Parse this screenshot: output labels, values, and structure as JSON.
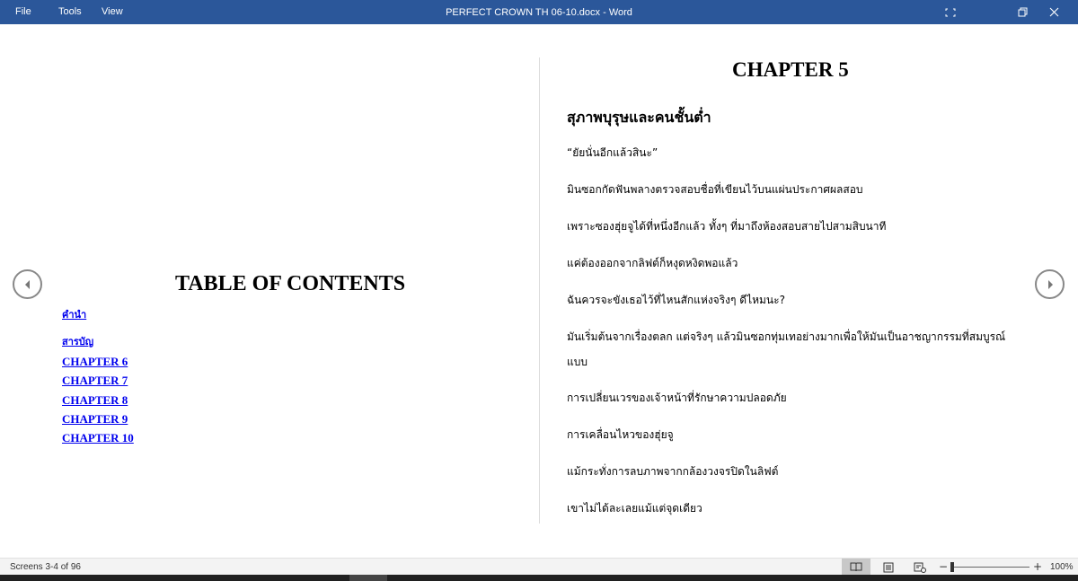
{
  "menu": {
    "file": "File",
    "tools": "Tools",
    "view": "View"
  },
  "window": {
    "title": "PERFECT CROWN TH 06-10.docx  -  Word"
  },
  "icons": {
    "focus": "focus-mode-icon",
    "restore": "restore-icon",
    "close": "close-icon",
    "prev": "chevron-left-icon",
    "next": "chevron-right-icon"
  },
  "toc": {
    "title": "TABLE OF CONTENTS",
    "items": [
      "คำนำ",
      "สารบัญ",
      "CHAPTER 6",
      "CHAPTER 7",
      "CHAPTER 8",
      "CHAPTER 9",
      "CHAPTER 10"
    ]
  },
  "chapter": {
    "title": "CHAPTER 5",
    "subtitle": "สุภาพบุรุษและคนชั้นต่ำ",
    "paragraphs": [
      "“ยัยนั่นอีกแล้วสินะ”",
      "มินซอกกัดฟันพลางตรวจสอบชื่อที่เขียนไว้บนแผ่นประกาศผลสอบ",
      "เพราะซองฮุ่ยจูได้ที่หนึ่งอีกแล้ว ทั้งๆ ที่มาถึงห้องสอบสายไปสามสิบนาที",
      "แค่ต้องออกจากลิฟต์ก็หงุดหงิดพอแล้ว",
      "ฉันควรจะขังเธอไว้ที่ไหนสักแห่งจริงๆ ดีไหมนะ?",
      "มันเริ่มต้นจากเรื่องตลก   แต่จริงๆ   แล้วมินซอกทุ่มเทอย่างมากเพื่อให้มันเป็นอาชญากรรมที่สมบูรณ์แบบ",
      "การเปลี่ยนเวรของเจ้าหน้าที่รักษาความปลอดภัย",
      "การเคลื่อนไหวของฮุ่ยจู",
      "แม้กระทั่งการลบภาพจากกล้องวงจรปิดในลิฟต์",
      "เขาไม่ได้ละเลยแม้แต่จุดเดียว"
    ]
  },
  "status": {
    "screens": "Screens 3-4 of 96",
    "zoom_minus": "−",
    "zoom_plus": "+",
    "zoom": "100%"
  },
  "colors": {
    "titlebar": "#2b579a",
    "link": "#0000ee"
  }
}
